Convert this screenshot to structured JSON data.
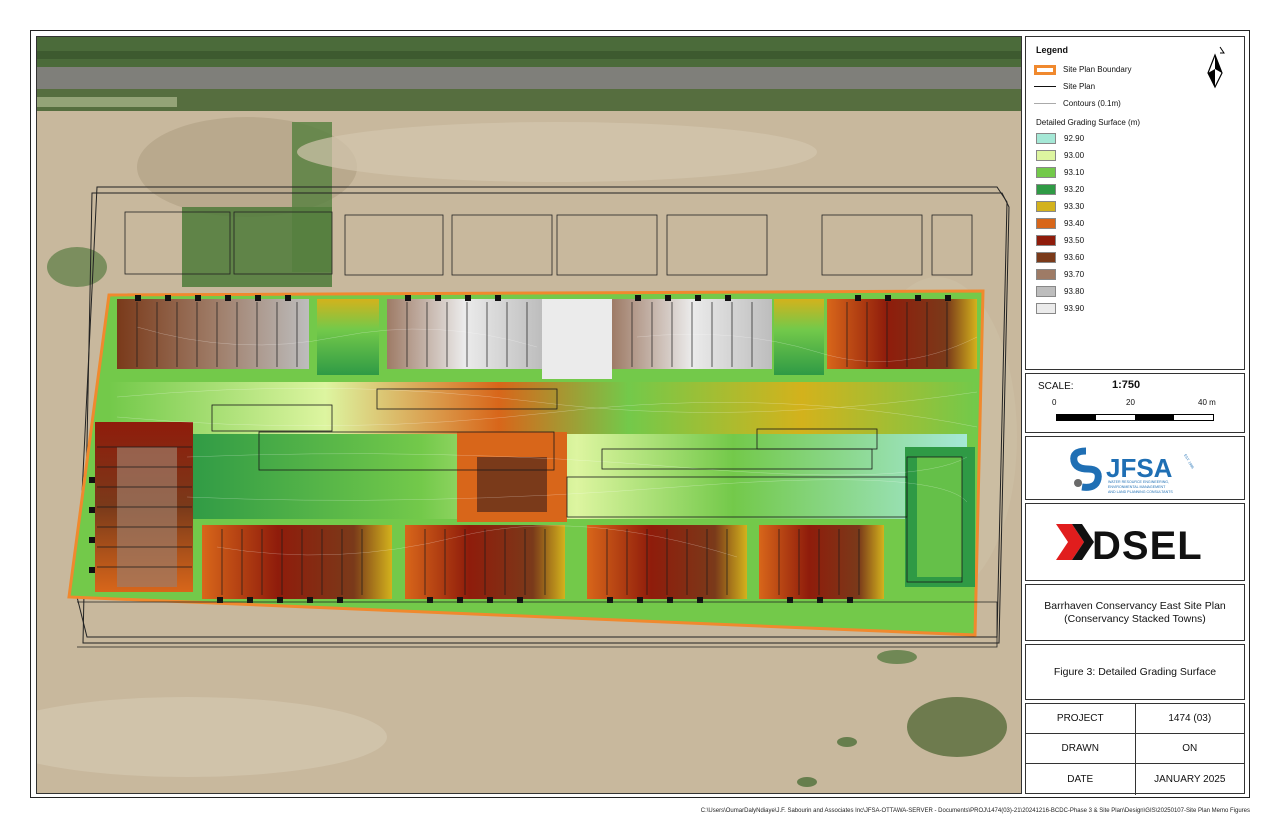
{
  "legend": {
    "title": "Legend",
    "items": [
      "Site Plan Boundary",
      "Site Plan",
      "Contours (0.1m)"
    ],
    "surface_title": "Detailed Grading Surface (m)",
    "classes": [
      {
        "value": "92.90",
        "color": "#a5e8d6"
      },
      {
        "value": "93.00",
        "color": "#ddf5a0"
      },
      {
        "value": "93.10",
        "color": "#73c94a"
      },
      {
        "value": "93.20",
        "color": "#2f9a45"
      },
      {
        "value": "93.30",
        "color": "#d3b21c"
      },
      {
        "value": "93.40",
        "color": "#d8661a"
      },
      {
        "value": "93.50",
        "color": "#8f1c0b"
      },
      {
        "value": "93.60",
        "color": "#7a3a1a"
      },
      {
        "value": "93.70",
        "color": "#9e7b66"
      },
      {
        "value": "93.80",
        "color": "#bdbdbd"
      },
      {
        "value": "93.90",
        "color": "#ebebeb"
      }
    ]
  },
  "scale": {
    "label": "SCALE:",
    "ratio": "1:750",
    "ticks": [
      "0",
      "20",
      "40 m"
    ]
  },
  "logos": {
    "jfsa_name": "JFSA",
    "jfsa_tagline_1": "WATER RESOURCE ENGINEERING,",
    "jfsa_tagline_2": "ENVIRONMENTAL MANAGEMENT",
    "jfsa_tagline_3": "AND LAND PLANNING CONSULTANTS",
    "jfsa_est": "EST. 1986",
    "dsel_name": "DSEL"
  },
  "title": {
    "line1": "Barrhaven Conservancy East Site Plan",
    "line2": "(Conservancy Stacked Towns)"
  },
  "figure": "Figure 3: Detailed Grading Surface",
  "info": [
    {
      "label": "PROJECT",
      "value": "1474 (03)"
    },
    {
      "label": "DRAWN",
      "value": "ON"
    },
    {
      "label": "DATE",
      "value": "JANUARY 2025"
    }
  ],
  "file_path": "C:\\Users\\OumarDalyNdiaye\\J.F. Sabourin and Associates Inc\\JFSA-OTTAWA-SERVER - Documents\\PROJ\\1474(03)-21\\20241216-BCDC-Phase 3 & Site Plan\\Design\\GIS\\20250107-Site Plan Memo Figures"
}
